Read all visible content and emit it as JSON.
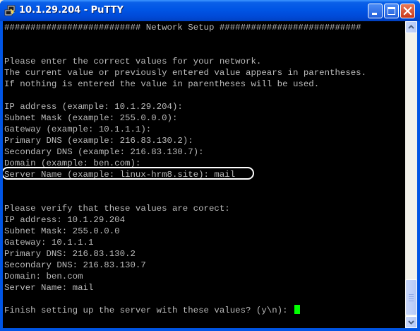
{
  "window": {
    "title": "10.1.29.204 - PuTTY"
  },
  "icons": {
    "app": "putty-icon",
    "minimize": "minimize-icon",
    "maximize": "maximize-icon",
    "close": "close-icon"
  },
  "colors": {
    "terminal_background": "#000000",
    "terminal_text": "#BBBBBB",
    "cursor": "#00FF00",
    "titlebar": "#0055E5",
    "highlight_ring": "#FFFFFF"
  },
  "terminal": {
    "lines": [
      "########################## Network Setup ###########################",
      "",
      "",
      "Please enter the correct values for your network.",
      "The current value or previously entered value appears in parentheses.",
      "If nothing is entered the value in parentheses will be used.",
      "",
      "IP address (example: 10.1.29.204):",
      "Subnet Mask (example: 255.0.0.0):",
      "Gateway (example: 10.1.1.1):",
      "Primary DNS (example: 216.83.130.2):",
      "Secondary DNS (example: 216.83.130.7):",
      "Domain (example: ben.com):",
      "Server Name (example: linux-hrm8.site): mail",
      "",
      "",
      "Please verify that these values are corect:",
      "IP address: 10.1.29.204",
      "Subnet Mask: 255.0.0.0",
      "Gateway: 10.1.1.1",
      "Primary DNS: 216.83.130.2",
      "Secondary DNS: 216.83.130.7",
      "Domain: ben.com",
      "Server Name: mail",
      "",
      "Finish setting up the server with these values? (y\\n): "
    ]
  }
}
